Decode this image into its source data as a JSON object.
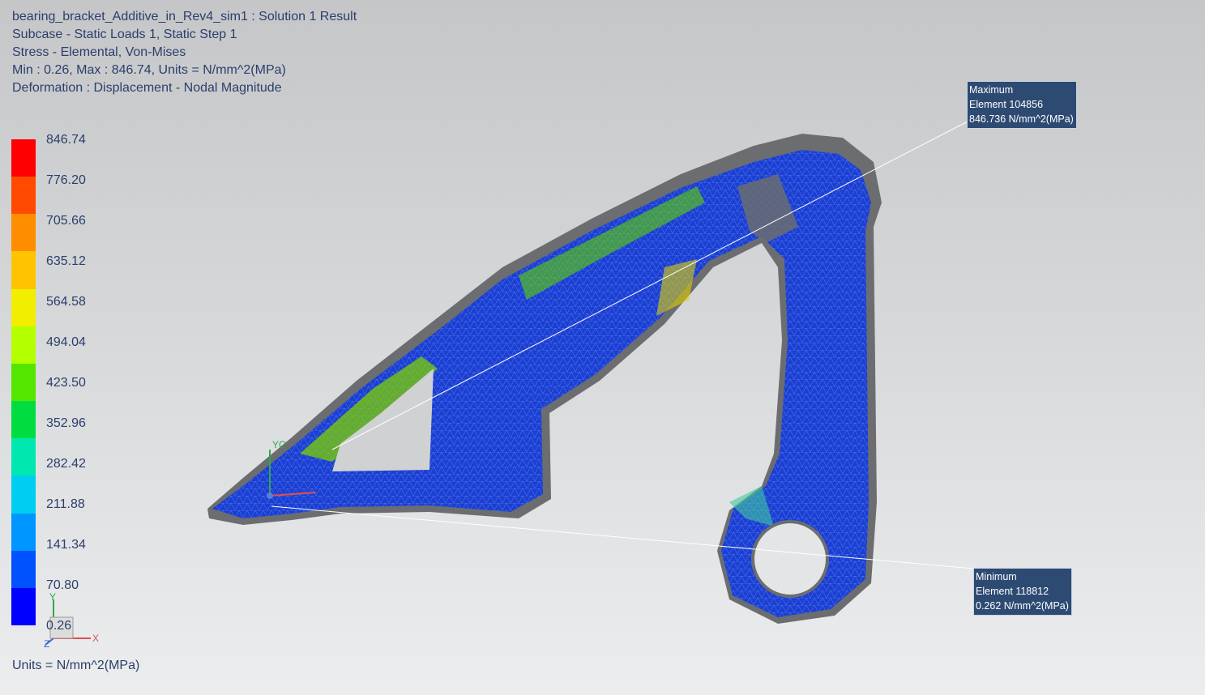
{
  "header": {
    "lines": [
      "bearing_bracket_Additive_in_Rev4_sim1 : Solution 1 Result",
      "Subcase - Static Loads 1, Static Step 1",
      "Stress - Elemental, Von-Mises",
      "Min : 0.26, Max : 846.74, Units = N/mm^2(MPa)",
      "Deformation : Displacement - Nodal Magnitude"
    ]
  },
  "legend": {
    "ticks": [
      "846.74",
      "776.20",
      "705.66",
      "635.12",
      "564.58",
      "494.04",
      "423.50",
      "352.96",
      "282.42",
      "211.88",
      "141.34",
      "70.80",
      "0.26"
    ],
    "colors": [
      "#ff0000",
      "#ff4a00",
      "#ff8d00",
      "#ffc300",
      "#f2ee00",
      "#b4ff00",
      "#55e600",
      "#00dd40",
      "#00e8b0",
      "#00cef0",
      "#0096ff",
      "#0052ff",
      "#0000ff"
    ],
    "units": "Units = N/mm^2(MPa)"
  },
  "callouts": {
    "max": {
      "line1": "Maximum",
      "line2": "Element 104856",
      "line3": "846.736 N/mm^2(MPa)"
    },
    "min": {
      "line1": "Minimum",
      "line2": "Element 118812",
      "line3": "0.262 N/mm^2(MPa)"
    }
  },
  "triad": {
    "y": "Y",
    "x": "X",
    "z": "Z",
    "yc": "YC"
  },
  "colors": {
    "text": "#2b3f6b",
    "callout_bg": "#2d4a72",
    "model_gray": "#6b6d70",
    "stress_low": "#1a3fd4"
  }
}
